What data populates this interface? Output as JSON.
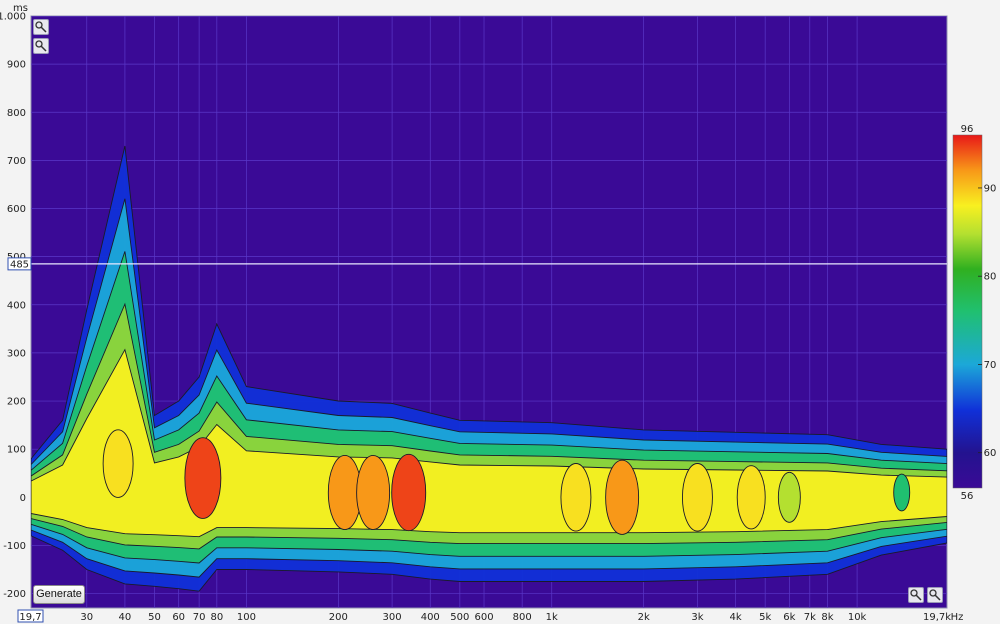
{
  "chart_data": {
    "type": "heatmap",
    "title": "",
    "xlabel": "",
    "x_unit": "Hz",
    "x_scale": "log",
    "x_range": [
      19.7,
      19700
    ],
    "x_start_label": "19,7",
    "x_end_label": "19,7k",
    "x_ticks": [
      "30",
      "40",
      "50",
      "60",
      "70",
      "80",
      "100",
      "200",
      "300",
      "400",
      "500",
      "600",
      "800",
      "1k",
      "2k",
      "3k",
      "4k",
      "5k",
      "6k",
      "7k",
      "8k",
      "10k"
    ],
    "x_tick_values": [
      30,
      40,
      50,
      60,
      70,
      80,
      100,
      200,
      300,
      400,
      500,
      600,
      800,
      1000,
      2000,
      3000,
      4000,
      5000,
      6000,
      7000,
      8000,
      10000
    ],
    "ylabel": "ms",
    "y_range": [
      -230,
      1000
    ],
    "y_ticks": [
      "1.000",
      "900",
      "800",
      "700",
      "600",
      "500",
      "400",
      "300",
      "200",
      "100",
      "0",
      "-100",
      "-200"
    ],
    "y_tick_values": [
      1000,
      900,
      800,
      700,
      600,
      500,
      400,
      300,
      200,
      100,
      0,
      -100,
      -200
    ],
    "cursor_time_ms": 485,
    "cursor_label": "485",
    "colorbar": {
      "min": 56,
      "max": 96,
      "min_label": "56",
      "max_label": "96",
      "ticks": [
        "90",
        "80",
        "70",
        "60"
      ],
      "tick_values": [
        90,
        80,
        70,
        60
      ]
    },
    "background_color": "#3a0a96",
    "decay_envelope": {
      "frequencies_hz": [
        19.7,
        25,
        30,
        40,
        50,
        60,
        70,
        80,
        100,
        200,
        300,
        400,
        500,
        1000,
        2000,
        4000,
        8000,
        12000,
        19700
      ],
      "end_time_ms": [
        80,
        160,
        390,
        730,
        170,
        200,
        250,
        360,
        230,
        200,
        195,
        175,
        160,
        155,
        140,
        135,
        130,
        110,
        100
      ],
      "start_time_ms": [
        -80,
        -110,
        -150,
        -180,
        -185,
        -190,
        -195,
        -150,
        -150,
        -155,
        -160,
        -170,
        -175,
        -175,
        -175,
        -170,
        -160,
        -120,
        -95
      ]
    },
    "peaks": [
      {
        "freq_hz": 38,
        "time_ms": 70,
        "level_db": 88
      },
      {
        "freq_hz": 72,
        "time_ms": 40,
        "level_db": 94
      },
      {
        "freq_hz": 210,
        "time_ms": 10,
        "level_db": 91
      },
      {
        "freq_hz": 260,
        "time_ms": 10,
        "level_db": 91
      },
      {
        "freq_hz": 340,
        "time_ms": 10,
        "level_db": 92
      },
      {
        "freq_hz": 1200,
        "time_ms": 0,
        "level_db": 88
      },
      {
        "freq_hz": 1700,
        "time_ms": 0,
        "level_db": 91
      },
      {
        "freq_hz": 3000,
        "time_ms": 0,
        "level_db": 88
      },
      {
        "freq_hz": 4500,
        "time_ms": 0,
        "level_db": 86
      },
      {
        "freq_hz": 6000,
        "time_ms": 0,
        "level_db": 80
      },
      {
        "freq_hz": 14000,
        "time_ms": 10,
        "level_db": 74
      }
    ]
  },
  "ui": {
    "generate_label": "Generate"
  }
}
